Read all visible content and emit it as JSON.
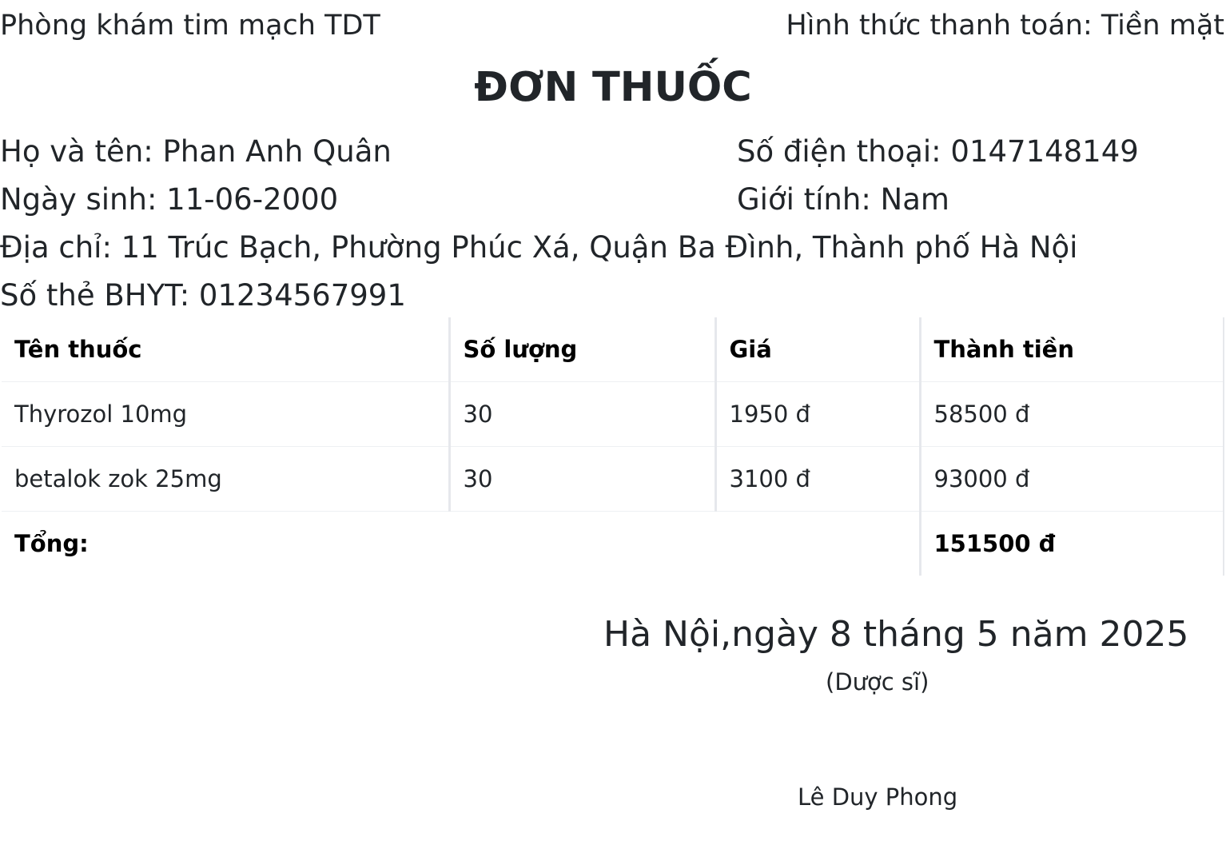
{
  "header": {
    "clinic": "Phòng khám tim mạch TDT",
    "payment": "Hình thức thanh toán: Tiền mặt"
  },
  "title": "ĐƠN THUỐC",
  "patient": {
    "name": "Họ và tên: Phan Anh Quân",
    "phone": "Số điện thoại: 0147148149",
    "dob": "Ngày sinh: 11-06-2000",
    "gender": "Giới tính: Nam",
    "address": "Địa chỉ: 11 Trúc Bạch, Phường Phúc Xá, Quận Ba Đình, Thành phố Hà Nội",
    "insurance": "Số thẻ BHYT: 01234567991"
  },
  "table": {
    "headers": [
      "Tên thuốc",
      "Số lượng",
      "Giá",
      "Thành tiền"
    ],
    "rows": [
      [
        "Thyrozol 10mg",
        "30",
        "1950 đ",
        "58500 đ"
      ],
      [
        "betalok zok 25mg",
        "30",
        "3100 đ",
        "93000 đ"
      ]
    ],
    "total_label": "Tổng:",
    "total_value": "151500 đ"
  },
  "signature": {
    "date": "Hà Nội,ngày 8 tháng 5 năm 2025",
    "role": "(Dược sĩ)",
    "name": "Lê Duy Phong"
  }
}
